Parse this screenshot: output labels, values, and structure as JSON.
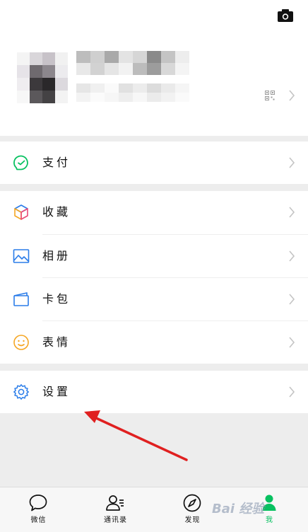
{
  "menu": {
    "pay": {
      "label": "支付",
      "icon": "pay-check-icon"
    },
    "favorites": {
      "label": "收藏",
      "icon": "cube-icon"
    },
    "album": {
      "label": "相册",
      "icon": "image-icon"
    },
    "cards": {
      "label": "卡包",
      "icon": "card-icon"
    },
    "stickers": {
      "label": "表情",
      "icon": "smile-icon"
    },
    "settings": {
      "label": "设置",
      "icon": "gear-icon"
    }
  },
  "tabbar": {
    "chats": {
      "label": "微信",
      "icon": "chat-bubble-icon"
    },
    "contacts": {
      "label": "通讯录",
      "icon": "contacts-icon"
    },
    "discover": {
      "label": "发现",
      "icon": "compass-icon"
    },
    "me": {
      "label": "我",
      "icon": "person-icon"
    }
  },
  "watermark": {
    "text": "Bai 经验"
  },
  "colors": {
    "accent_green": "#07c160",
    "annotation_red": "#e02020",
    "background": "#ededed"
  }
}
